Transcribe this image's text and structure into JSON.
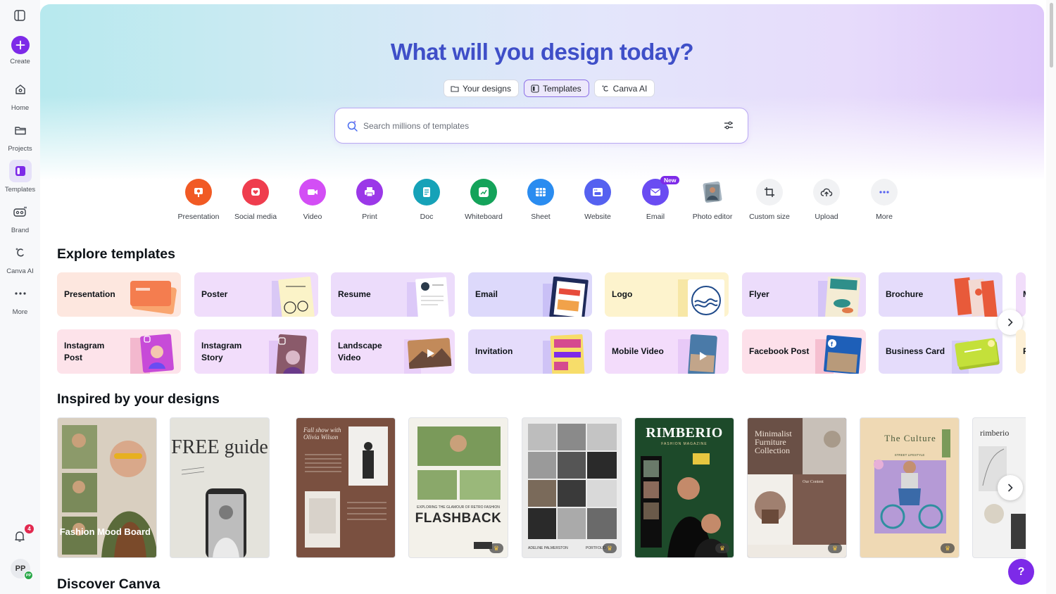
{
  "sidebar": {
    "items": [
      {
        "label": "Create",
        "icon": "plus-icon"
      },
      {
        "label": "Home",
        "icon": "home-icon"
      },
      {
        "label": "Projects",
        "icon": "folder-icon"
      },
      {
        "label": "Templates",
        "icon": "templates-icon"
      },
      {
        "label": "Brand",
        "icon": "brand-icon"
      },
      {
        "label": "Canva AI",
        "icon": "canva-ai-icon"
      },
      {
        "label": "More",
        "icon": "more-dots-icon"
      }
    ],
    "notification_count": "4",
    "avatar_initials": "PP",
    "avatar_sub": "PP"
  },
  "hero": {
    "title": "What will you design today?",
    "tabs": [
      {
        "label": "Your designs"
      },
      {
        "label": "Templates"
      },
      {
        "label": "Canva AI"
      }
    ],
    "search_placeholder": "Search millions of templates"
  },
  "quick_create": [
    {
      "label": "Presentation",
      "color": "#f15a24"
    },
    {
      "label": "Social media",
      "color": "#ef3d4e"
    },
    {
      "label": "Video",
      "color": "#d34ef5"
    },
    {
      "label": "Print",
      "color": "#9b38e8"
    },
    {
      "label": "Doc",
      "color": "#16a2b8"
    },
    {
      "label": "Whiteboard",
      "color": "#14a35a"
    },
    {
      "label": "Sheet",
      "color": "#2a8cf0"
    },
    {
      "label": "Website",
      "color": "#5561f0"
    },
    {
      "label": "Email",
      "color": "#6a4cf2",
      "badge": "New"
    },
    {
      "label": "Photo editor",
      "color": "#7a8a94"
    },
    {
      "label": "Custom size",
      "color": "#f1f2f4"
    },
    {
      "label": "Upload",
      "color": "#f1f2f4"
    },
    {
      "label": "More",
      "color": "#f1f2f4"
    }
  ],
  "explore": {
    "title": "Explore templates",
    "row1": [
      {
        "label": "Presentation",
        "bg": "#fde7df",
        "art": "#f4885a"
      },
      {
        "label": "Poster",
        "bg": "#f0ddfb",
        "art": "#f6e7a6"
      },
      {
        "label": "Resume",
        "bg": "#ecdcfb",
        "art": "#ffffff"
      },
      {
        "label": "Email",
        "bg": "#ddd9fb",
        "art": "#e74c3c"
      },
      {
        "label": "Logo",
        "bg": "#fdf3cd",
        "art": "#1f4a8a"
      },
      {
        "label": "Flyer",
        "bg": "#ecdcfb",
        "art": "#2f8f8a"
      },
      {
        "label": "Brochure",
        "bg": "#e5dcfb",
        "art": "#e85a3a"
      },
      {
        "label": "M",
        "bg": "#f1ddfa",
        "art": "#c4a5f5"
      }
    ],
    "row2": [
      {
        "label": "Instagram Post",
        "bg": "#fde3ea",
        "art": "#c74bd8"
      },
      {
        "label": "Instagram Story",
        "bg": "#f2ddfb",
        "art": "#8a5a6a"
      },
      {
        "label": "Landscape Video",
        "bg": "#f1ddfb",
        "art": "#c28a5a"
      },
      {
        "label": "Invitation",
        "bg": "#e5dcfb",
        "art": "#d54a8f"
      },
      {
        "label": "Mobile Video",
        "bg": "#f3dcfb",
        "art": "#4a7aa8"
      },
      {
        "label": "Facebook Post",
        "bg": "#fde0ea",
        "art": "#1e5fb8"
      },
      {
        "label": "Business Card",
        "bg": "#e5dcfb",
        "art": "#c4e03a"
      },
      {
        "label": "F",
        "bg": "#fdf0d6",
        "art": "#f4c542"
      }
    ]
  },
  "inspired": {
    "title": "Inspired by your designs",
    "cards": [
      {
        "text": "Fashion Mood Board",
        "bg": "#d9cfc0"
      },
      {
        "text": "FREE guide",
        "bg": "#e4e3dc"
      },
      {
        "text": "Fall show with Olivia Wilson",
        "bg": "#7a5040"
      },
      {
        "text": "FLASHBACK",
        "bg": "#f3f1ea",
        "sub": "EXPLORING THE GLAMOUR OF RETRO FASHION"
      },
      {
        "text": "PORTFOLIO",
        "bg": "#ebebeb",
        "sub": "ADELINE PALMERSTON"
      },
      {
        "text": "RIMBERIO",
        "bg": "#1d4a2a",
        "sub": "FASHION MAGAZINE"
      },
      {
        "text": "Minimalist Furniture Collection",
        "bg": "#7a5a4e",
        "sub": "Our Content"
      },
      {
        "text": "The Culture",
        "bg": "#efd9b4",
        "sub": "STREET LIFESTYLE"
      },
      {
        "text": "rimberio",
        "bg": "#f2f2f2"
      }
    ]
  },
  "discover": {
    "title": "Discover Canva"
  },
  "help_label": "?"
}
